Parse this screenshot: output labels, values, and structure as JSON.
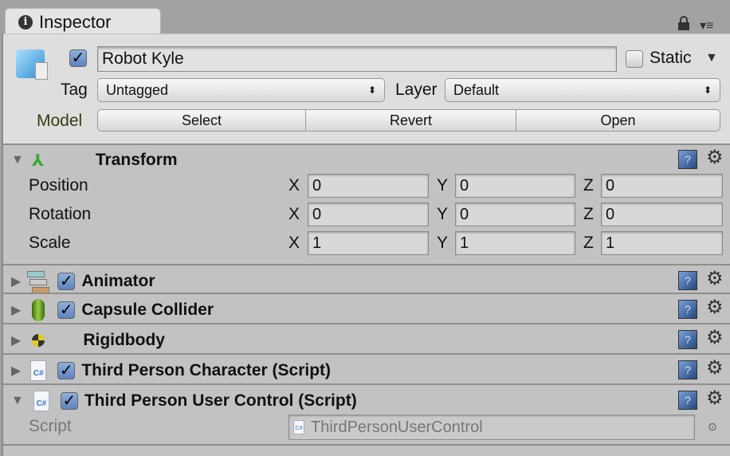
{
  "tab": {
    "title": "Inspector",
    "icon": "info-icon"
  },
  "toolbar": {
    "lock_icon": "lock-icon",
    "menu_icon": "menu-icon"
  },
  "object": {
    "active": true,
    "name": "Robot Kyle",
    "static_label": "Static",
    "static": false,
    "tag_label": "Tag",
    "tag": "Untagged",
    "layer_label": "Layer",
    "layer": "Default",
    "model_label": "Model",
    "model_buttons": [
      "Select",
      "Revert",
      "Open"
    ]
  },
  "transform": {
    "title": "Transform",
    "rows": [
      {
        "label": "Position",
        "x": "0",
        "y": "0",
        "z": "0"
      },
      {
        "label": "Rotation",
        "x": "0",
        "y": "0",
        "z": "0"
      },
      {
        "label": "Scale",
        "x": "1",
        "y": "1",
        "z": "1"
      }
    ],
    "axes": [
      "X",
      "Y",
      "Z"
    ]
  },
  "components": [
    {
      "title": "Animator",
      "enabled": true,
      "icon": "animator-icon"
    },
    {
      "title": "Capsule Collider",
      "enabled": true,
      "icon": "capsule-icon"
    },
    {
      "title": "Rigidbody",
      "icon": "rigidbody-icon"
    },
    {
      "title": "Third Person Character (Script)",
      "enabled": true,
      "icon": "csharp-script-icon"
    },
    {
      "title": "Third Person User Control (Script)",
      "enabled": true,
      "icon": "csharp-script-icon",
      "expanded": true
    }
  ],
  "script_field": {
    "label": "Script",
    "value": "ThirdPersonUserControl",
    "icon_text": "C#"
  },
  "colors": {
    "model_label": "#3a3a10",
    "header_bg": "#dedede",
    "body_bg": "#c2c2c2"
  }
}
